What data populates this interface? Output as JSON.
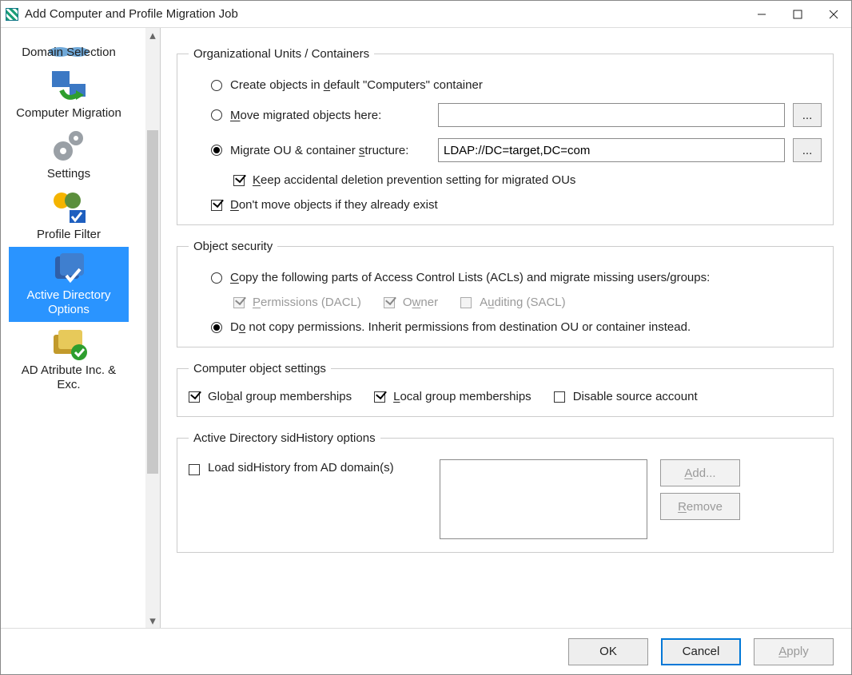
{
  "window": {
    "title": "Add Computer and Profile Migration Job"
  },
  "sidebar": {
    "items": [
      {
        "label": "Domain Selection"
      },
      {
        "label": "Computer Migration"
      },
      {
        "label": "Settings"
      },
      {
        "label": "Profile Filter"
      },
      {
        "label": "Active Directory Options"
      },
      {
        "label": "AD Atribute Inc. & Exc."
      }
    ],
    "selected_index": 4
  },
  "org_units": {
    "legend": "Organizational Units / Containers",
    "create_default_label": "Create objects in default \"Computers\" container",
    "move_here_label": "Move migrated objects here:",
    "move_here_value": "",
    "migrate_structure_label": "Migrate OU & container structure:",
    "migrate_structure_value": "LDAP://DC=target,DC=com",
    "selected": "migrate_structure",
    "keep_deletion_label": "Keep accidental deletion prevention setting for migrated OUs",
    "keep_deletion_checked": true,
    "dont_move_label": "Don't move objects if they already exist",
    "dont_move_checked": true,
    "browse_label": "..."
  },
  "security": {
    "legend": "Object security",
    "copy_acls_label": "Copy the following parts of Access Control Lists (ACLs) and migrate missing users/groups:",
    "permissions_label": "Permissions (DACL)",
    "permissions_checked": true,
    "owner_label": "Owner",
    "owner_checked": true,
    "auditing_label": "Auditing (SACL)",
    "auditing_checked": false,
    "do_not_copy_label": "Do not copy permissions. Inherit permissions from destination OU or container instead.",
    "selected": "do_not_copy"
  },
  "computer_settings": {
    "legend": "Computer object settings",
    "global_label": "Global group memberships",
    "global_checked": true,
    "local_label": "Local group memberships",
    "local_checked": true,
    "disable_label": "Disable source account",
    "disable_checked": false
  },
  "sid_history": {
    "legend": "Active Directory sidHistory options",
    "load_label": "Load sidHistory from AD domain(s)",
    "load_checked": false,
    "add_label": "Add...",
    "remove_label": "Remove"
  },
  "footer": {
    "ok": "OK",
    "cancel": "Cancel",
    "apply": "Apply"
  }
}
